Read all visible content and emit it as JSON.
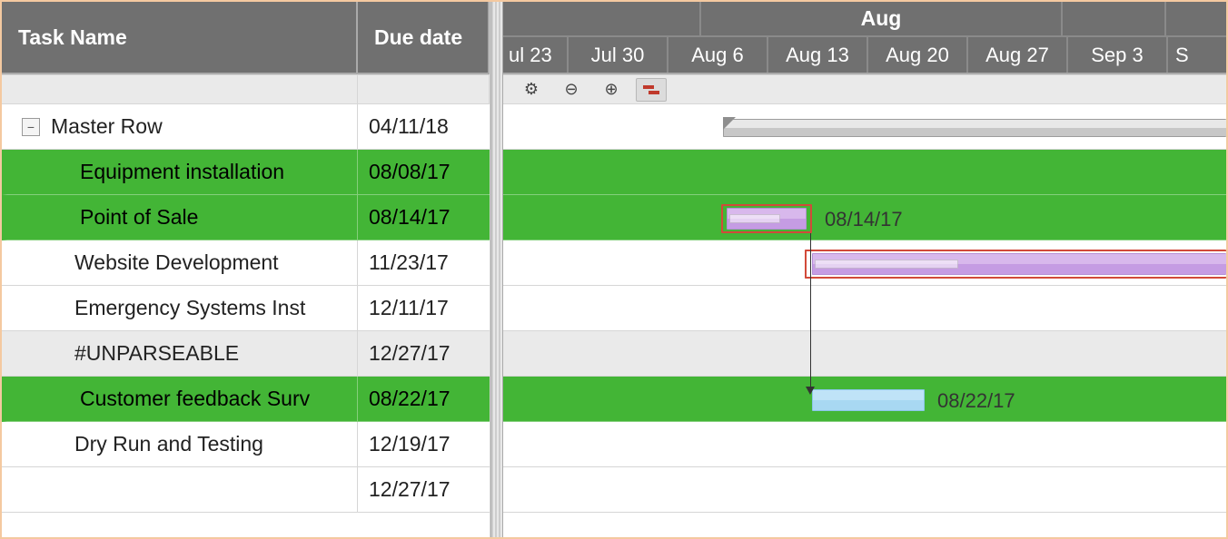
{
  "columns": {
    "task": "Task Name",
    "due": "Due date"
  },
  "timeline": {
    "month_label": "Aug",
    "weeks": [
      "ul 23",
      "Jul 30",
      "Aug 6",
      "Aug 13",
      "Aug 20",
      "Aug 27",
      "Sep 3",
      "S"
    ]
  },
  "toolbar": {
    "settings": "⚙",
    "zoom_out": "⊖",
    "zoom_in": "⊕"
  },
  "rows": [
    {
      "task": "Master Row",
      "due": "04/11/18",
      "type": "master",
      "indent": 0
    },
    {
      "task": "Equipment installation",
      "due": "08/08/17",
      "type": "green",
      "indent": 1
    },
    {
      "task": "Point of Sale",
      "due": "08/14/17",
      "type": "green",
      "indent": 1,
      "bar_label": "08/14/17"
    },
    {
      "task": "Website Development",
      "due": "11/23/17",
      "type": "plain",
      "indent": 1
    },
    {
      "task": "Emergency Systems Inst",
      "due": "12/11/17",
      "type": "plain",
      "indent": 1
    },
    {
      "task": "#UNPARSEABLE",
      "due": "12/27/17",
      "type": "muted",
      "indent": 1
    },
    {
      "task": "Customer feedback Surv",
      "due": "08/22/17",
      "type": "green",
      "indent": 1,
      "bar_label": "08/22/17"
    },
    {
      "task": "Dry Run and Testing",
      "due": "12/19/17",
      "type": "plain",
      "indent": 1
    },
    {
      "task": "",
      "due": "12/27/17",
      "type": "plain",
      "indent": 1
    }
  ]
}
